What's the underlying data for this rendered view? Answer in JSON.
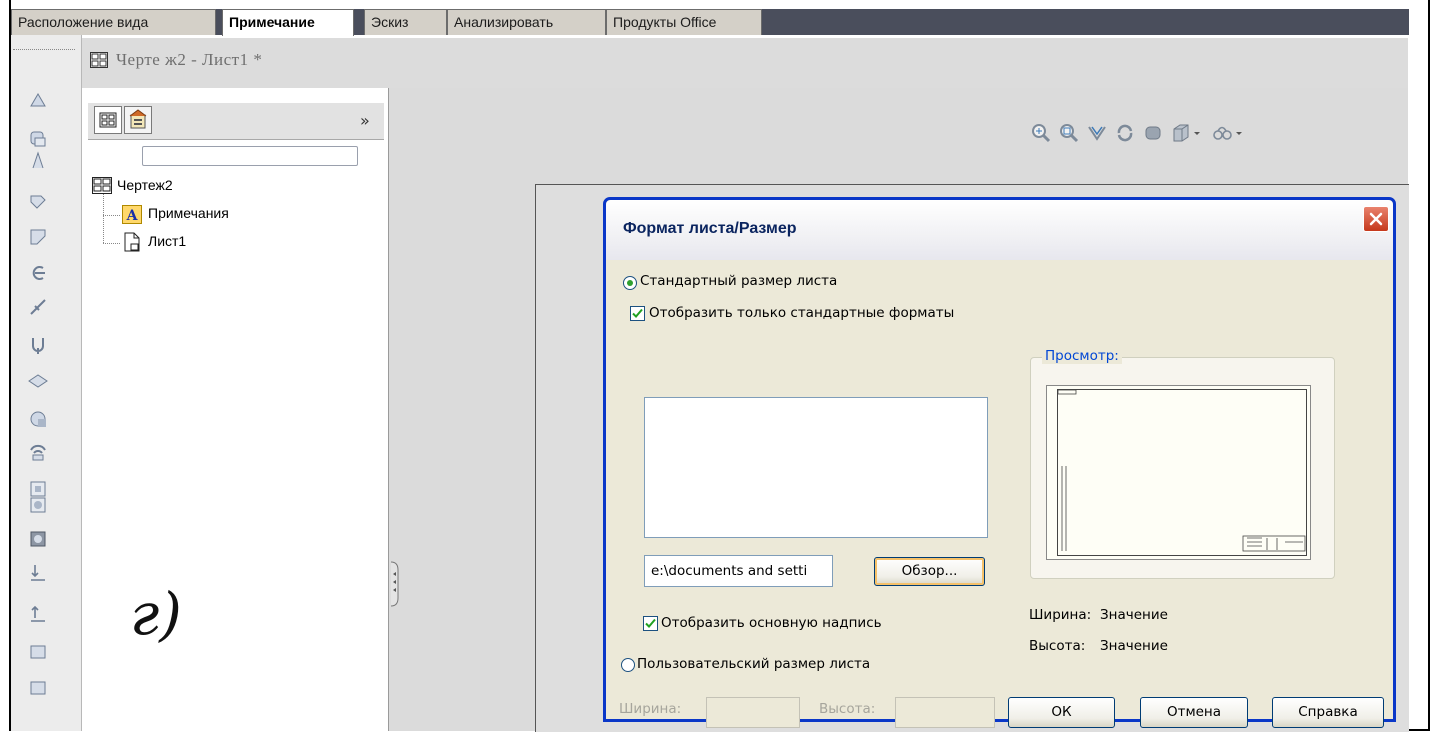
{
  "tabs": [
    {
      "label": "Расположение вида",
      "active": false
    },
    {
      "label": "Примечание",
      "active": true
    },
    {
      "label": "Эскиз",
      "active": false
    },
    {
      "label": "Анализировать",
      "active": false
    },
    {
      "label": "Продукты Office",
      "active": false
    }
  ],
  "document": {
    "title": "Черте ж2 - Лист1 *"
  },
  "feature_manager": {
    "expand_glyph": "»",
    "tree": {
      "root": "Чертеж2",
      "children": [
        "Примечания",
        "Лист1"
      ]
    },
    "handwritten_label": "г)"
  },
  "left_strip_icons": [
    "smart-dimension-icon",
    "model-items-icon",
    "spell-icon",
    "format-painter-icon",
    "note-icon",
    "balloon-icon",
    "auto-balloon-icon",
    "surface-finish-icon",
    "weld-symbol-icon",
    "hole-callout-icon",
    "gtol-icon",
    "datum-icon",
    "block-icon",
    "center-mark-icon",
    "centerline-icon",
    "area-hatch-icon",
    "revision-icon",
    "table-icon"
  ],
  "headsup_icons": [
    "zoom-to-fit-icon",
    "zoom-to-area-icon",
    "previous-view-icon",
    "rotate-icon",
    "pan-icon",
    "display-style-icon",
    "hide-show-icon"
  ],
  "dialog": {
    "title": "Формат листа/Размер",
    "standard_radio": "Стандартный размер листа",
    "standard_selected": true,
    "only_standard_check": "Отобразить только стандартные форматы",
    "only_standard_checked": true,
    "path_value": "e:\\documents and setti",
    "browse_button": "Обзор...",
    "show_title_block_check": "Отобразить основную надпись",
    "show_title_block_checked": true,
    "custom_radio": "Пользовательский размер листа",
    "custom_selected": false,
    "preview_legend": "Просмотр:",
    "width_label": "Ширина:",
    "width_value": "Значение",
    "height_label": "Высота:",
    "height_value": "Значение",
    "custom_width_label": "Ширина:",
    "custom_height_label": "Высота:",
    "ok_button": "ОК",
    "cancel_button": "Отмена",
    "help_button": "Справка"
  },
  "colors": {
    "dialog_border": "#0a37c8",
    "radio_dot": "#2fa02f",
    "title_text": "#0a245f",
    "legend_text": "#0046d5"
  }
}
